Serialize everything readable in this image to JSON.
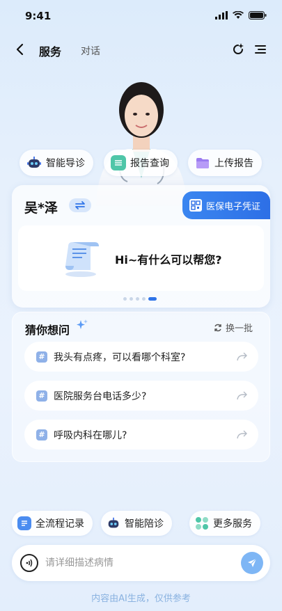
{
  "status_bar": {
    "time": "9:41"
  },
  "nav": {
    "active_tab": "服务",
    "tab": "对话"
  },
  "quick_chips": [
    {
      "label": "智能导诊",
      "icon": "robot-icon"
    },
    {
      "label": "报告查询",
      "icon": "report-icon"
    },
    {
      "label": "上传报告",
      "icon": "folder-icon"
    }
  ],
  "patient": {
    "name": "吴*泽"
  },
  "insurance": {
    "label": "医保电子凭证"
  },
  "greeting": {
    "text": "Hi~有什么可以帮您?"
  },
  "carousel": {
    "total": 5,
    "active_index": 4
  },
  "guess": {
    "title": "猜你想问",
    "refresh_label": "换一批",
    "questions": [
      "我头有点疼，可以看哪个科室?",
      "医院服务台电话多少?",
      "呼吸内科在哪儿?"
    ]
  },
  "actions": [
    {
      "label": "全流程记录",
      "icon": "record-icon"
    },
    {
      "label": "智能陪诊",
      "icon": "robot-icon"
    },
    {
      "label": "更多服务",
      "icon": "grid-icon"
    }
  ],
  "input": {
    "placeholder": "请详细描述病情",
    "value": ""
  },
  "disclaimer": "内容由AI生成，仅供参考",
  "colors": {
    "accent": "#2f74e8",
    "send": "#7eb6f5",
    "disclaimer": "#8ab2e0"
  }
}
